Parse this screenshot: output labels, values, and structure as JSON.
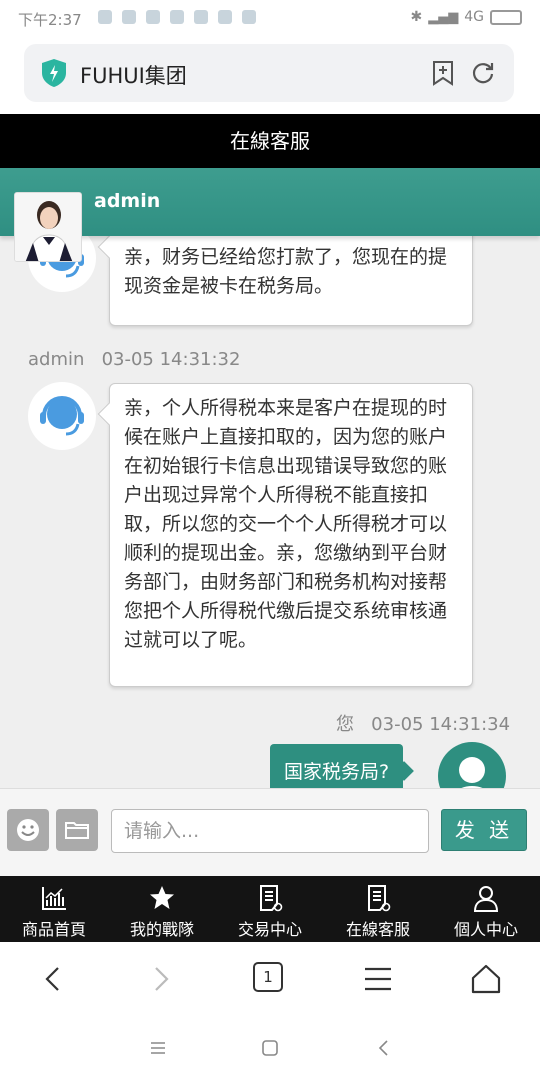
{
  "status_bar": {
    "time": "下午2:37",
    "network": "4G"
  },
  "browser": {
    "site_title": "FUHUI集团",
    "tab_count": "1"
  },
  "page": {
    "header": "在線客服"
  },
  "agent": {
    "name": "admin"
  },
  "messages": [
    {
      "sender": "admin",
      "time": "",
      "text": "亲，财务已经给您打款了，您现在的提现资金是被卡在税务局。"
    },
    {
      "sender": "admin",
      "time": "03-05 14:31:32",
      "text": "亲，个人所得税本来是客户在提现的时候在账户上直接扣取的，因为您的账户在初始银行卡信息出现错误导致您的账户出现过异常个人所得税不能直接扣取，所以您的交一个个人所得税才可以顺利的提现出金。亲，您缴纳到平台财务部门，由财务部门和税务机构对接帮您把个人所得税代缴后提交系统审核通过就可以了呢。"
    },
    {
      "sender": "您",
      "time": "03-05 14:31:34",
      "text": "国家税务局?"
    }
  ],
  "input": {
    "placeholder": "请输入...",
    "send_label": "发 送"
  },
  "site_nav": [
    {
      "label": "商品首頁",
      "icon": "chart-icon"
    },
    {
      "label": "我的戰隊",
      "icon": "star-icon"
    },
    {
      "label": "交易中心",
      "icon": "document-icon"
    },
    {
      "label": "在線客服",
      "icon": "document-icon"
    },
    {
      "label": "個人中心",
      "icon": "person-icon"
    }
  ],
  "colors": {
    "teal": "#2e8f80",
    "header_black": "#000000",
    "nav_black": "#141414"
  }
}
